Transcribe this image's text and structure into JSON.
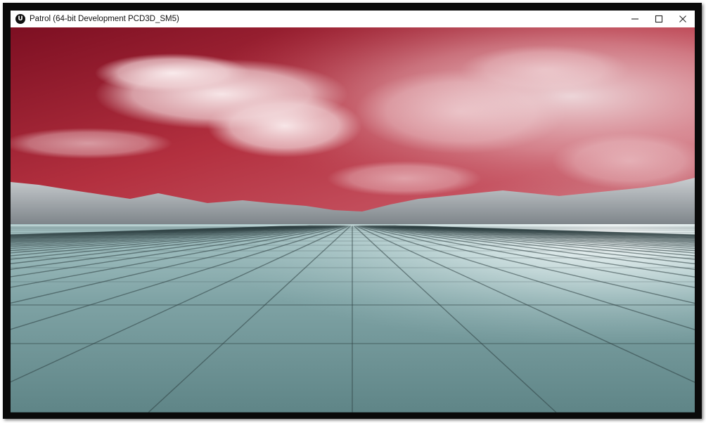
{
  "window": {
    "title": "Patrol (64-bit Development PCD3D_SM5)",
    "app_icon": "unreal-engine-icon",
    "app_icon_glyph": "U",
    "controls": [
      "minimize-icon",
      "maximize-icon",
      "close-icon"
    ]
  },
  "scene": {
    "sky_color": "#b5333f",
    "floor_color": "#8fb3b4",
    "mountain_color": "#9aa1a6"
  }
}
